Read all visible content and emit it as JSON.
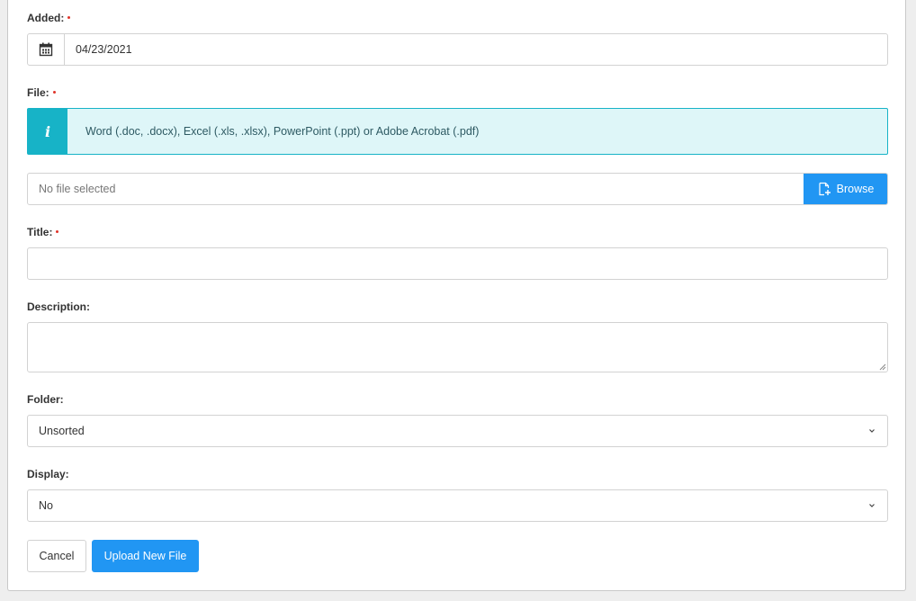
{
  "form": {
    "added": {
      "label": "Added:",
      "value": "04/23/2021",
      "required": true,
      "icon": "calendar-icon"
    },
    "file": {
      "label": "File:",
      "required": true,
      "info_text": "Word (.doc, .docx), Excel (.xls, .xlsx), PowerPoint (.ppt) or Adobe Acrobat (.pdf)",
      "info_icon": "info-icon",
      "placeholder": "No file selected",
      "browse_label": "Browse",
      "browse_icon": "file-add-icon"
    },
    "title": {
      "label": "Title:",
      "required": true,
      "value": ""
    },
    "description": {
      "label": "Description:",
      "value": ""
    },
    "folder": {
      "label": "Folder:",
      "selected": "Unsorted"
    },
    "display": {
      "label": "Display:",
      "selected": "No"
    }
  },
  "actions": {
    "cancel_label": "Cancel",
    "upload_label": "Upload New File"
  },
  "colors": {
    "primary": "#2196f3",
    "info_accent": "#17b3c7",
    "info_bg": "#def6f8",
    "required": "#e0342a",
    "border": "#d2d2d2"
  }
}
